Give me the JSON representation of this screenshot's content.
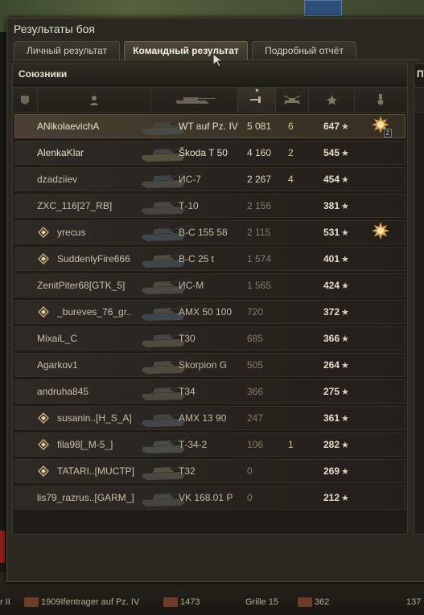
{
  "window": {
    "title": "Результаты боя"
  },
  "tabs": [
    {
      "label": "Личный результат",
      "active": false
    },
    {
      "label": "Командный результат",
      "active": true
    },
    {
      "label": "Подробный отчёт",
      "active": false
    }
  ],
  "allies": {
    "header": "Союзники",
    "columns": [
      "squad-icon",
      "player-icon",
      "tank-icon",
      "damage-icon",
      "kills-icon",
      "xp-star-icon",
      "medal-icon"
    ],
    "sorted_column": "damage",
    "rows": [
      {
        "name": "ANikolaevichA",
        "platoon": false,
        "tank": "WT auf Pz. IV",
        "damage": "5 081",
        "kills": "6",
        "xp": "647",
        "medal": "order-medal",
        "medal_count": "2",
        "self": true,
        "bright": true
      },
      {
        "name": "AlenkaKlar",
        "platoon": false,
        "tank": "Škoda T 50",
        "damage": "4 160",
        "kills": "2",
        "xp": "545",
        "medal": "",
        "medal_count": "",
        "self": false,
        "bright": true
      },
      {
        "name": "dzadziiev",
        "platoon": false,
        "tank": "ИС-7",
        "damage": "2 267",
        "kills": "4",
        "xp": "454",
        "medal": "",
        "medal_count": "",
        "self": false,
        "bright": false
      },
      {
        "name": "ZXC_116[27_RB]",
        "platoon": false,
        "tank": "Т-10",
        "damage": "2 156",
        "kills": "",
        "xp": "381",
        "medal": "",
        "medal_count": "",
        "self": false,
        "bright": false
      },
      {
        "name": "yrecus",
        "platoon": true,
        "tank": "В-С 155 58",
        "damage": "2 115",
        "kills": "",
        "xp": "531",
        "medal": "order-medal",
        "medal_count": "",
        "self": false,
        "bright": false
      },
      {
        "name": "SuddenlyFire666",
        "platoon": true,
        "tank": "В-С 25 t",
        "damage": "1 574",
        "kills": "",
        "xp": "401",
        "medal": "",
        "medal_count": "",
        "self": false,
        "bright": false
      },
      {
        "name": "ZenitPiter68[GTK_5]",
        "platoon": false,
        "tank": "ИС-М",
        "damage": "1 565",
        "kills": "",
        "xp": "424",
        "medal": "",
        "medal_count": "",
        "self": false,
        "bright": false
      },
      {
        "name": "_bureves_76_gr..",
        "platoon": true,
        "tank": "AMX 50 100",
        "damage": "720",
        "kills": "",
        "xp": "372",
        "medal": "",
        "medal_count": "",
        "self": false,
        "bright": false
      },
      {
        "name": "MixaiL_C",
        "platoon": false,
        "tank": "T30",
        "damage": "685",
        "kills": "",
        "xp": "366",
        "medal": "",
        "medal_count": "",
        "self": false,
        "bright": false
      },
      {
        "name": "Agarkov1",
        "platoon": false,
        "tank": "Skorpion G",
        "damage": "505",
        "kills": "",
        "xp": "264",
        "medal": "",
        "medal_count": "",
        "self": false,
        "bright": false
      },
      {
        "name": "andruha845",
        "platoon": false,
        "tank": "T34",
        "damage": "366",
        "kills": "",
        "xp": "275",
        "medal": "",
        "medal_count": "",
        "self": false,
        "bright": false
      },
      {
        "name": "susanin..[H_S_A]",
        "platoon": true,
        "tank": "AMX 13 90",
        "damage": "247",
        "kills": "",
        "xp": "361",
        "medal": "",
        "medal_count": "",
        "self": false,
        "bright": false
      },
      {
        "name": "fila98[_M-5_]",
        "platoon": true,
        "tank": "Т-34-2",
        "damage": "106",
        "kills": "1",
        "xp": "282",
        "medal": "",
        "medal_count": "",
        "self": false,
        "bright": false
      },
      {
        "name": "TATARI..[MUCTP]",
        "platoon": true,
        "tank": "T32",
        "damage": "0",
        "kills": "",
        "xp": "269",
        "medal": "",
        "medal_count": "",
        "self": false,
        "bright": false
      },
      {
        "name": "lis79_razrus..[GARM_]",
        "platoon": false,
        "tank": "VK 168.01 P",
        "damage": "0",
        "kills": "",
        "xp": "212",
        "medal": "",
        "medal_count": "",
        "self": false,
        "bright": false
      }
    ]
  },
  "enemies": {
    "header": "П"
  },
  "bottom_bar": {
    "left_fragment": "r II",
    "vehicle_a": "1909Ifentrager auf Pz. IV",
    "value_b": "1473",
    "vehicle_c": "Grille 15",
    "value_d": "362",
    "right_fragment": "137"
  },
  "colors": {
    "accent_gold": "#e1c77e",
    "self_row": "#4a4031",
    "text": "#cfc7b4"
  }
}
